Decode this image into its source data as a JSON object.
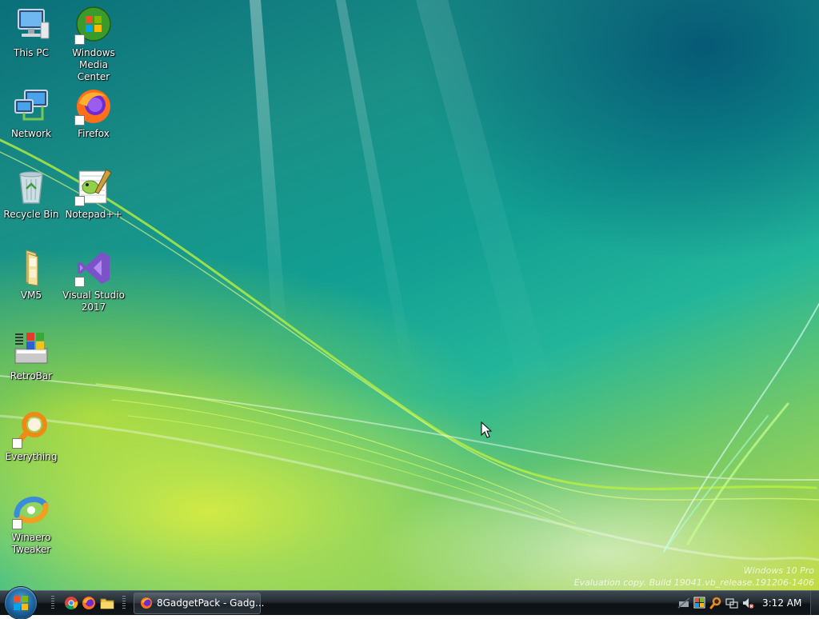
{
  "desktop_icons": [
    {
      "label": "This PC",
      "icon": "computer-icon"
    },
    {
      "label": "Windows\nMedia Center",
      "icon": "media-center-icon"
    },
    {
      "label": "Network",
      "icon": "network-icon"
    },
    {
      "label": "Firefox",
      "icon": "firefox-icon"
    },
    {
      "label": "Recycle Bin",
      "icon": "recycle-bin-icon"
    },
    {
      "label": "Notepad++",
      "icon": "notepad-plus-plus-icon"
    },
    {
      "label": "VM5",
      "icon": "folder-icon"
    },
    {
      "label": "Visual Studio\n2017",
      "icon": "visual-studio-icon"
    },
    {
      "label": "RetroBar",
      "icon": "retrobar-icon"
    },
    {
      "label": "Everything",
      "icon": "everything-search-icon"
    },
    {
      "label": "Winaero\nTweaker",
      "icon": "winaero-tweaker-icon"
    }
  ],
  "watermark": {
    "line1": "Windows 10 Pro",
    "line2": "Evaluation copy. Build 19041.vb_release.191206-1406"
  },
  "taskbar": {
    "quick_launch": [
      "chrome-icon",
      "firefox-icon",
      "file-explorer-icon"
    ],
    "open_window_label": "8GadgetPack - Gadg...",
    "tray_icons": [
      "network-icon",
      "security-flag-icon",
      "search-icon",
      "display-icon",
      "volume-muted-icon"
    ],
    "clock": "3:12 AM"
  }
}
